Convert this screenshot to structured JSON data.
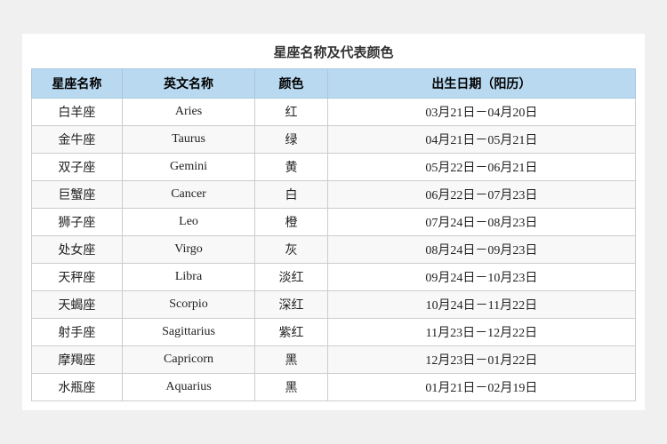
{
  "title": "星座名称及代表颜色",
  "headers": {
    "name": "星座名称",
    "english": "英文名称",
    "color": "颜色",
    "date": "出生日期（阳历）"
  },
  "rows": [
    {
      "name": "白羊座",
      "english": "Aries",
      "color": "红",
      "date": "03月21日－04月20日"
    },
    {
      "name": "金牛座",
      "english": "Taurus",
      "color": "绿",
      "date": "04月21日－05月21日"
    },
    {
      "name": "双子座",
      "english": "Gemini",
      "color": "黄",
      "date": "05月22日－06月21日"
    },
    {
      "name": "巨蟹座",
      "english": "Cancer",
      "color": "白",
      "date": "06月22日－07月23日"
    },
    {
      "name": "狮子座",
      "english": "Leo",
      "color": "橙",
      "date": "07月24日－08月23日"
    },
    {
      "name": "处女座",
      "english": "Virgo",
      "color": "灰",
      "date": "08月24日－09月23日"
    },
    {
      "name": "天秤座",
      "english": "Libra",
      "color": "淡红",
      "date": "09月24日－10月23日"
    },
    {
      "name": "天蝎座",
      "english": "Scorpio",
      "color": "深红",
      "date": "10月24日－11月22日"
    },
    {
      "name": "射手座",
      "english": "Sagittarius",
      "color": "紫红",
      "date": "11月23日－12月22日"
    },
    {
      "name": "摩羯座",
      "english": "Capricorn",
      "color": "黑",
      "date": "12月23日－01月22日"
    },
    {
      "name": "水瓶座",
      "english": "Aquarius",
      "color": "黑",
      "date": "01月21日－02月19日"
    }
  ]
}
